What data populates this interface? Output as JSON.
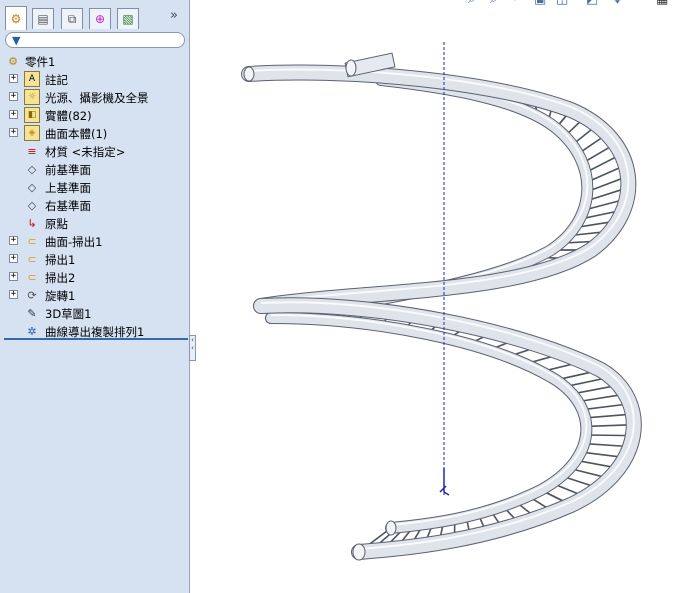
{
  "tabs": [
    {
      "name": "featuremanager-tab",
      "icon": "featuremanager-icon",
      "glyph": "⚙"
    },
    {
      "name": "propertymanager-tab",
      "icon": "propertymanager-icon",
      "glyph": "▤"
    },
    {
      "name": "configurationmanager-tab",
      "icon": "configurationmanager-icon",
      "glyph": "⧉"
    },
    {
      "name": "dimxpert-tab",
      "icon": "crosshair-icon",
      "glyph": "⊕"
    },
    {
      "name": "display-manager-tab",
      "icon": "display-manager-icon",
      "glyph": "▧"
    }
  ],
  "expand_glyph": "»",
  "tree": {
    "root": "零件1",
    "items": [
      {
        "label": "註記",
        "icon": "annotations-icon",
        "glyph": "A",
        "expandable": true
      },
      {
        "label": "光源、攝影機及全景",
        "icon": "lights-cameras-icon",
        "glyph": "☼",
        "expandable": true
      },
      {
        "label": "實體(82)",
        "icon": "solid-bodies-icon",
        "glyph": "◧",
        "expandable": true
      },
      {
        "label": "曲面本體(1)",
        "icon": "surface-bodies-icon",
        "glyph": "◈",
        "expandable": true
      },
      {
        "label": "材質 <未指定>",
        "icon": "material-icon",
        "glyph": "≡",
        "expandable": false
      },
      {
        "label": "前基準面",
        "icon": "plane-icon",
        "glyph": "◇",
        "expandable": false
      },
      {
        "label": "上基準面",
        "icon": "plane-icon",
        "glyph": "◇",
        "expandable": false
      },
      {
        "label": "右基準面",
        "icon": "plane-icon",
        "glyph": "◇",
        "expandable": false
      },
      {
        "label": "原點",
        "icon": "origin-icon",
        "glyph": "↳",
        "expandable": false
      },
      {
        "label": "曲面-掃出1",
        "icon": "surface-sweep-icon",
        "glyph": "⊂",
        "expandable": true
      },
      {
        "label": "掃出1",
        "icon": "sweep-icon",
        "glyph": "⊂",
        "expandable": true
      },
      {
        "label": "掃出2",
        "icon": "sweep-icon",
        "glyph": "⊂",
        "expandable": true
      },
      {
        "label": "旋轉1",
        "icon": "revolve-icon",
        "glyph": "⟳",
        "expandable": true
      },
      {
        "label": "3D草圖1",
        "icon": "sketch3d-icon",
        "glyph": "✎",
        "expandable": false
      },
      {
        "label": "曲線導出複製排列1",
        "icon": "curve-pattern-icon",
        "glyph": "✲",
        "expandable": false
      }
    ]
  },
  "colors": {
    "panel": "#d6e2f2",
    "tube": "#dfe3ea",
    "edge": "#5b6270",
    "axis": "#1a2bb8"
  }
}
